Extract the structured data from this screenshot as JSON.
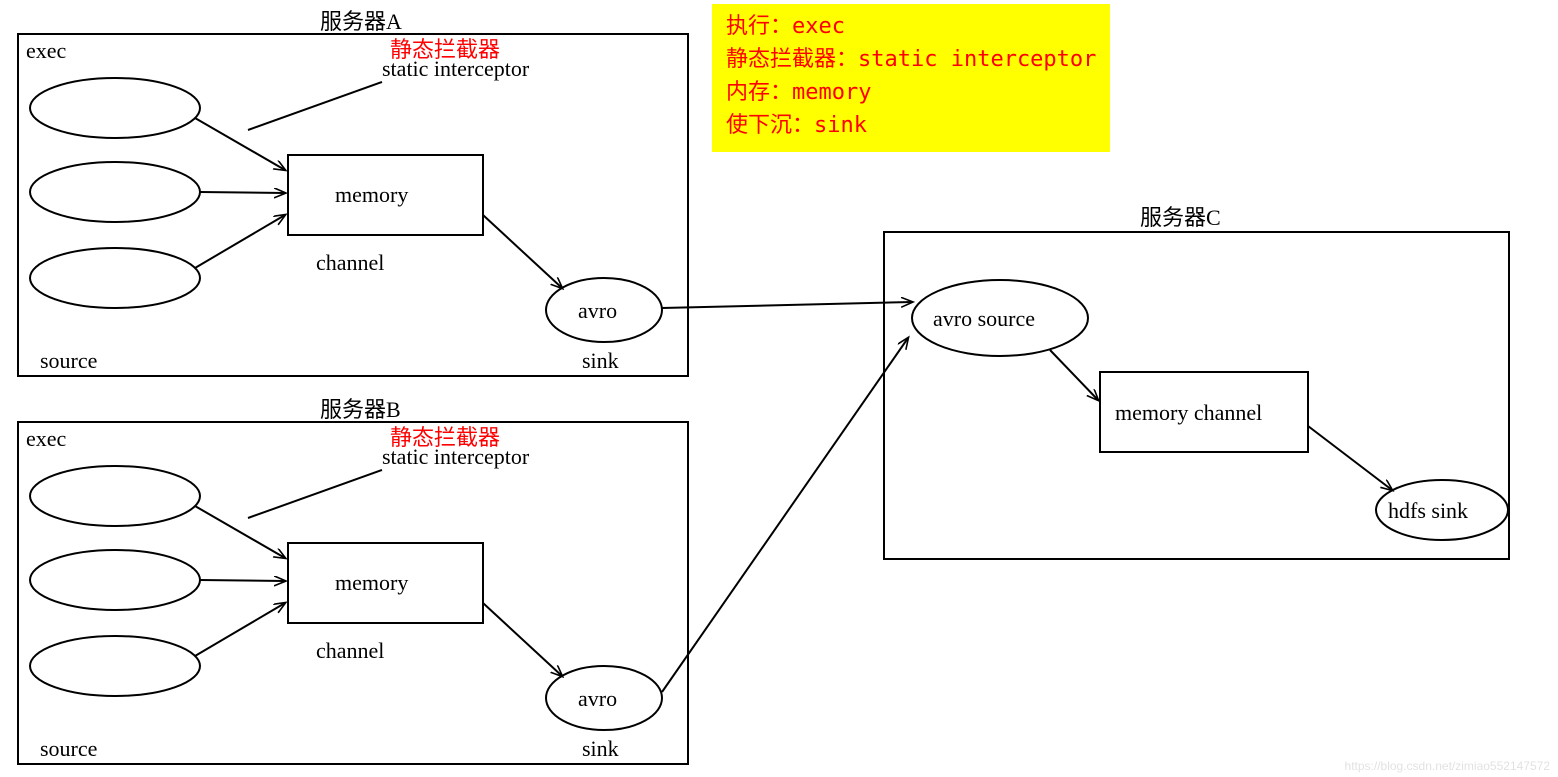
{
  "serverA": {
    "title": "服务器A",
    "exec": "exec",
    "interceptor_cn": "静态拦截器",
    "interceptor_en": "static interceptor",
    "memory": "memory",
    "channel": "channel",
    "avro": "avro",
    "sink": "sink",
    "source": "source"
  },
  "serverB": {
    "title": "服务器B",
    "exec": "exec",
    "interceptor_cn": "静态拦截器",
    "interceptor_en": "static interceptor",
    "memory": "memory",
    "channel": "channel",
    "avro": "avro",
    "sink": "sink",
    "source": "source"
  },
  "serverC": {
    "title": "服务器C",
    "avro_source": "avro source",
    "memory_channel": "memory channel",
    "hdfs_sink": "hdfs sink"
  },
  "legend": {
    "line1": "执行：exec",
    "line2": "静态拦截器：static interceptor",
    "line3": "内存：memory",
    "line4": "使下沉：sink"
  },
  "watermark": "https://blog.csdn.net/zimiao552147572"
}
